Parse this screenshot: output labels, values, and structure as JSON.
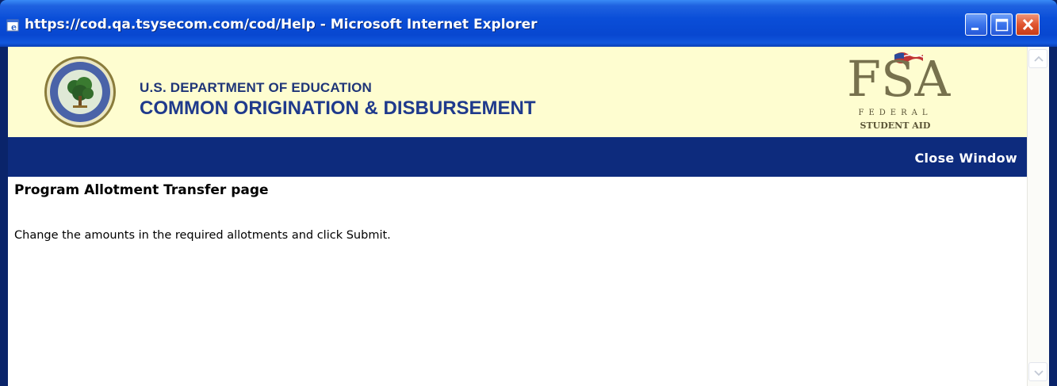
{
  "window": {
    "title": "https://cod.qa.tsysecom.com/cod/Help - Microsoft Internet Explorer",
    "icons": {
      "app": "ie-icon",
      "minimize": "minimize-icon",
      "maximize": "maximize-icon",
      "close": "close-icon"
    }
  },
  "banner": {
    "dept_line1": "U.S. DEPARTMENT OF EDUCATION",
    "dept_line2": "COMMON ORIGINATION & DISBURSEMENT",
    "seal_icon": "department-of-education-seal",
    "fsa_logo": {
      "big": "FSA",
      "line1": "FEDERAL",
      "line2": "STUDENT AID"
    },
    "background": "#fefdd0"
  },
  "nav": {
    "close_window": "Close Window",
    "background": "#0d2b7d"
  },
  "page": {
    "heading": "Program Allotment Transfer page",
    "instructions": "Change the amounts in the required allotments and click Submit."
  },
  "scrollbar": {
    "up_icon": "scroll-up-icon",
    "down_icon": "scroll-down-icon"
  }
}
